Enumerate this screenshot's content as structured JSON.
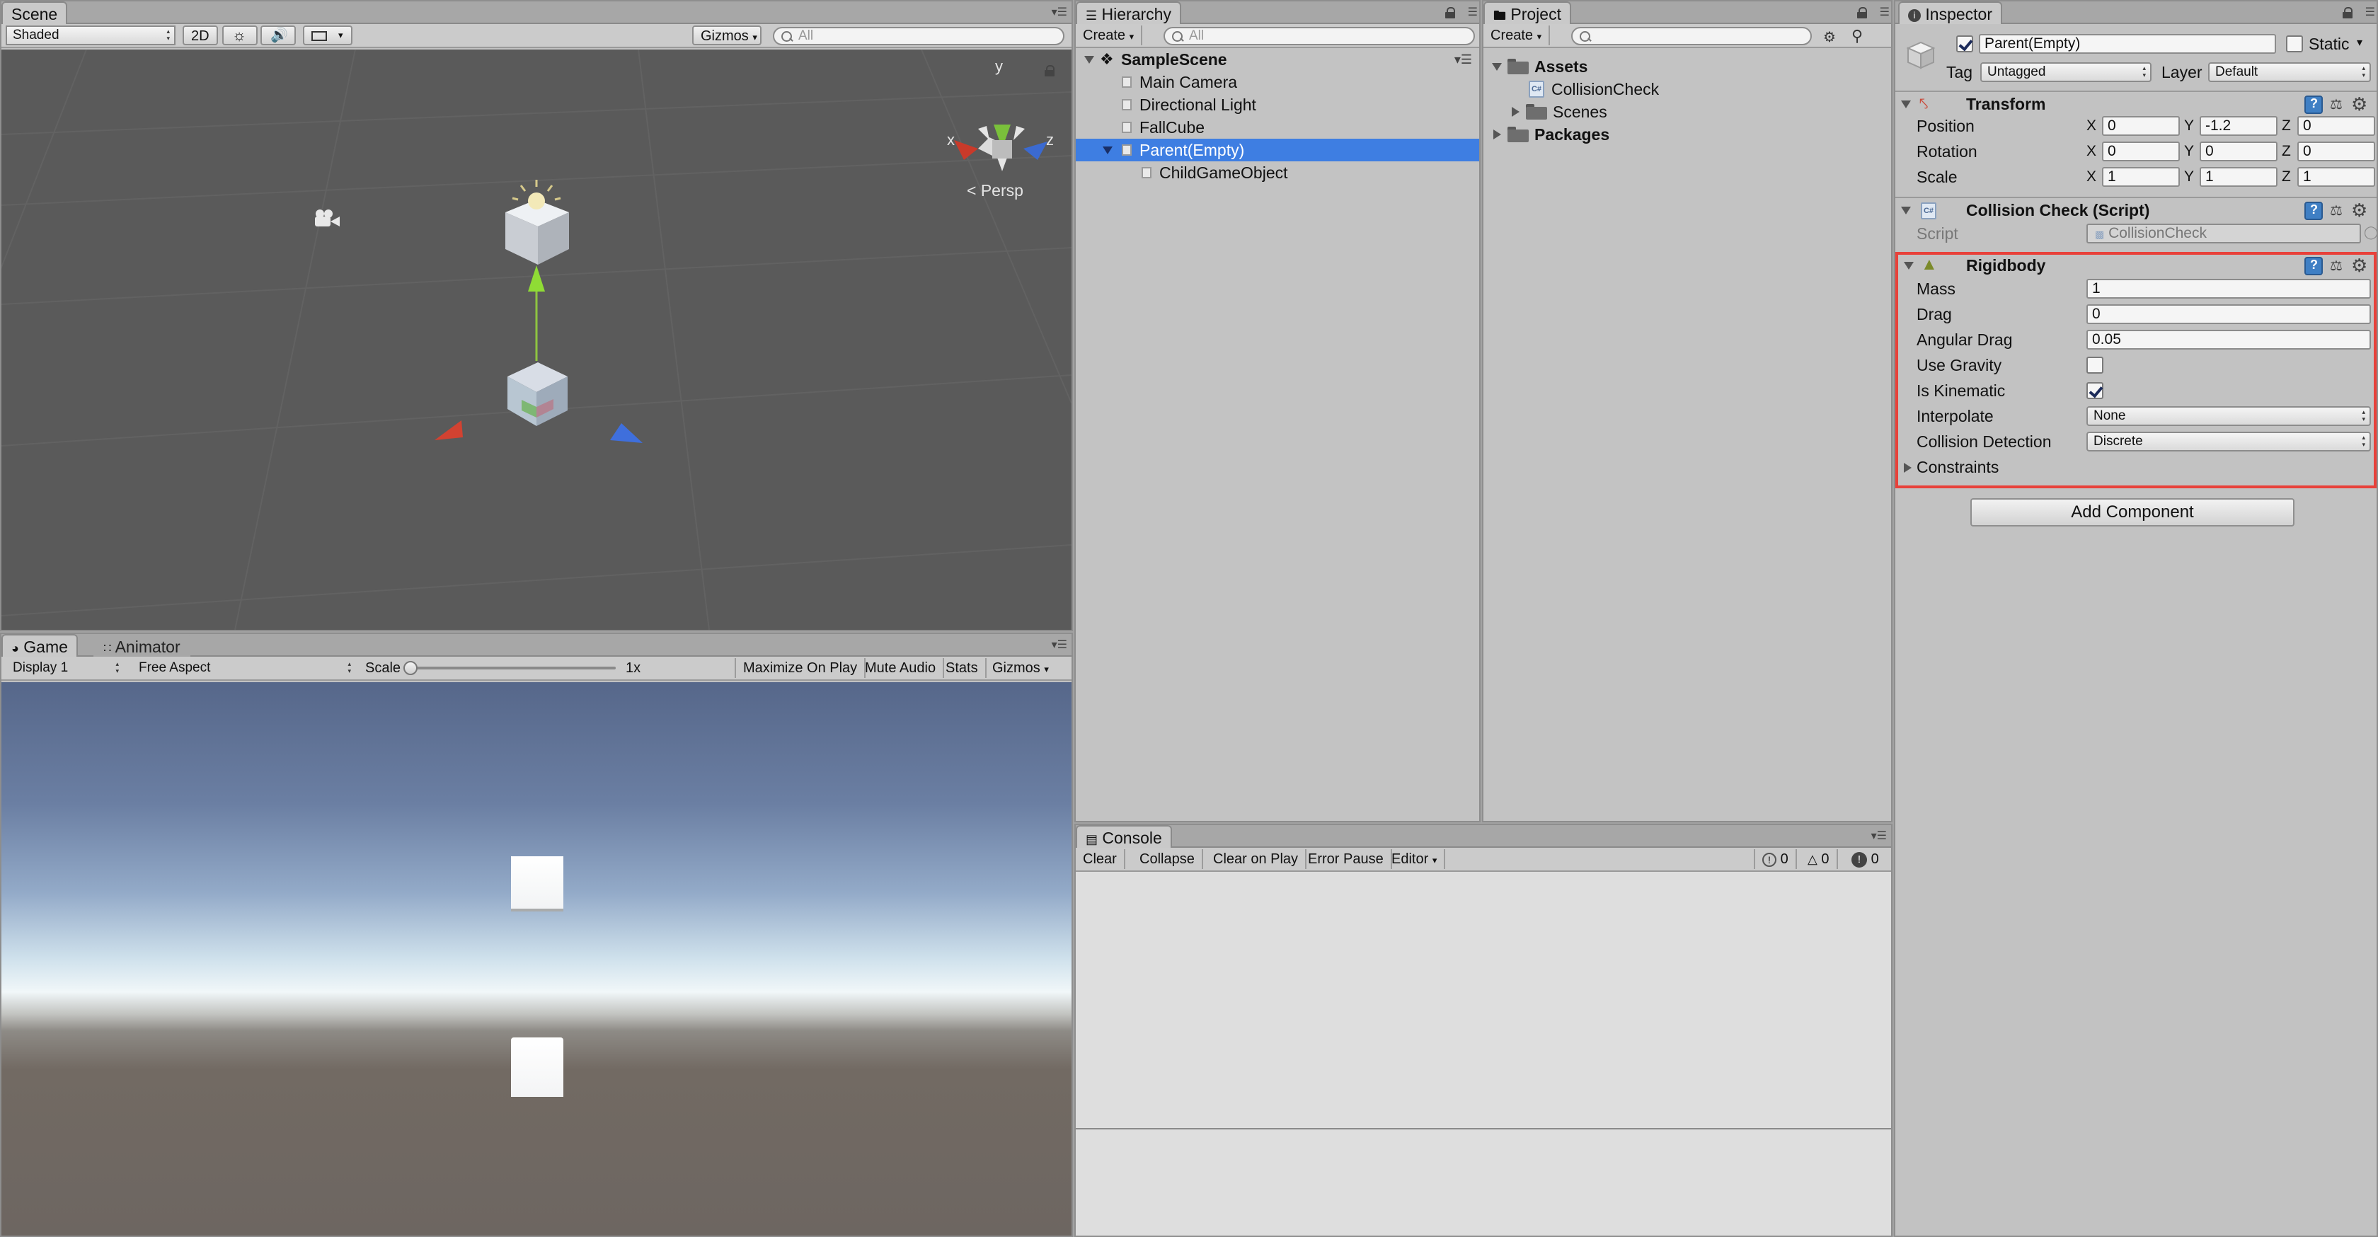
{
  "scene": {
    "tab": "Scene",
    "shading_mode": "Shaded",
    "toggle_2d": "2D",
    "gizmos": "Gizmos",
    "search_placeholder": "All",
    "projection": "Persp",
    "axis_x": "x",
    "axis_y": "y",
    "axis_z": "z"
  },
  "game": {
    "tab": "Game",
    "tab_animator": "Animator",
    "display": "Display 1",
    "aspect": "Free Aspect",
    "scale_label": "Scale",
    "scale_value": "1x",
    "maximize_on_play": "Maximize On Play",
    "mute_audio": "Mute Audio",
    "stats": "Stats",
    "gizmos": "Gizmos"
  },
  "hierarchy": {
    "tab": "Hierarchy",
    "create": "Create",
    "search_placeholder": "All",
    "scene_name": "SampleScene",
    "items": [
      {
        "label": "Main Camera"
      },
      {
        "label": "Directional Light"
      },
      {
        "label": "FallCube"
      },
      {
        "label": "Parent(Empty)",
        "selected": true
      },
      {
        "label": "ChildGameObject"
      }
    ]
  },
  "project": {
    "tab": "Project",
    "create": "Create",
    "assets": "Assets",
    "collision_check": "CollisionCheck",
    "scenes": "Scenes",
    "packages": "Packages"
  },
  "console": {
    "tab": "Console",
    "clear": "Clear",
    "collapse": "Collapse",
    "clear_on_play": "Clear on Play",
    "error_pause": "Error Pause",
    "editor": "Editor",
    "log_count": "0",
    "warning_count": "0",
    "error_count": "0"
  },
  "inspector": {
    "tab": "Inspector",
    "object_name": "Parent(Empty)",
    "active": true,
    "static_label": "Static",
    "tag_label": "Tag",
    "tag_value": "Untagged",
    "layer_label": "Layer",
    "layer_value": "Default",
    "transform": {
      "title": "Transform",
      "position_label": "Position",
      "rotation_label": "Rotation",
      "scale_label": "Scale",
      "position": {
        "x": "0",
        "y": "-1.2",
        "z": "0"
      },
      "rotation": {
        "x": "0",
        "y": "0",
        "z": "0"
      },
      "scale": {
        "x": "1",
        "y": "1",
        "z": "1"
      }
    },
    "collision_check": {
      "title": "Collision Check (Script)",
      "script_label": "Script",
      "script_value": "CollisionCheck"
    },
    "rigidbody": {
      "title": "Rigidbody",
      "mass_label": "Mass",
      "mass": "1",
      "drag_label": "Drag",
      "drag": "0",
      "angular_drag_label": "Angular Drag",
      "angular_drag": "0.05",
      "use_gravity_label": "Use Gravity",
      "use_gravity": false,
      "is_kinematic_label": "Is Kinematic",
      "is_kinematic": true,
      "interpolate_label": "Interpolate",
      "interpolate": "None",
      "collision_detection_label": "Collision Detection",
      "collision_detection": "Discrete",
      "constraints_label": "Constraints"
    },
    "add_component": "Add Component"
  },
  "colors": {
    "selection": "#3e7ee2",
    "highlight_border": "#e8413a",
    "scene_bg": "#5a5a5a"
  }
}
